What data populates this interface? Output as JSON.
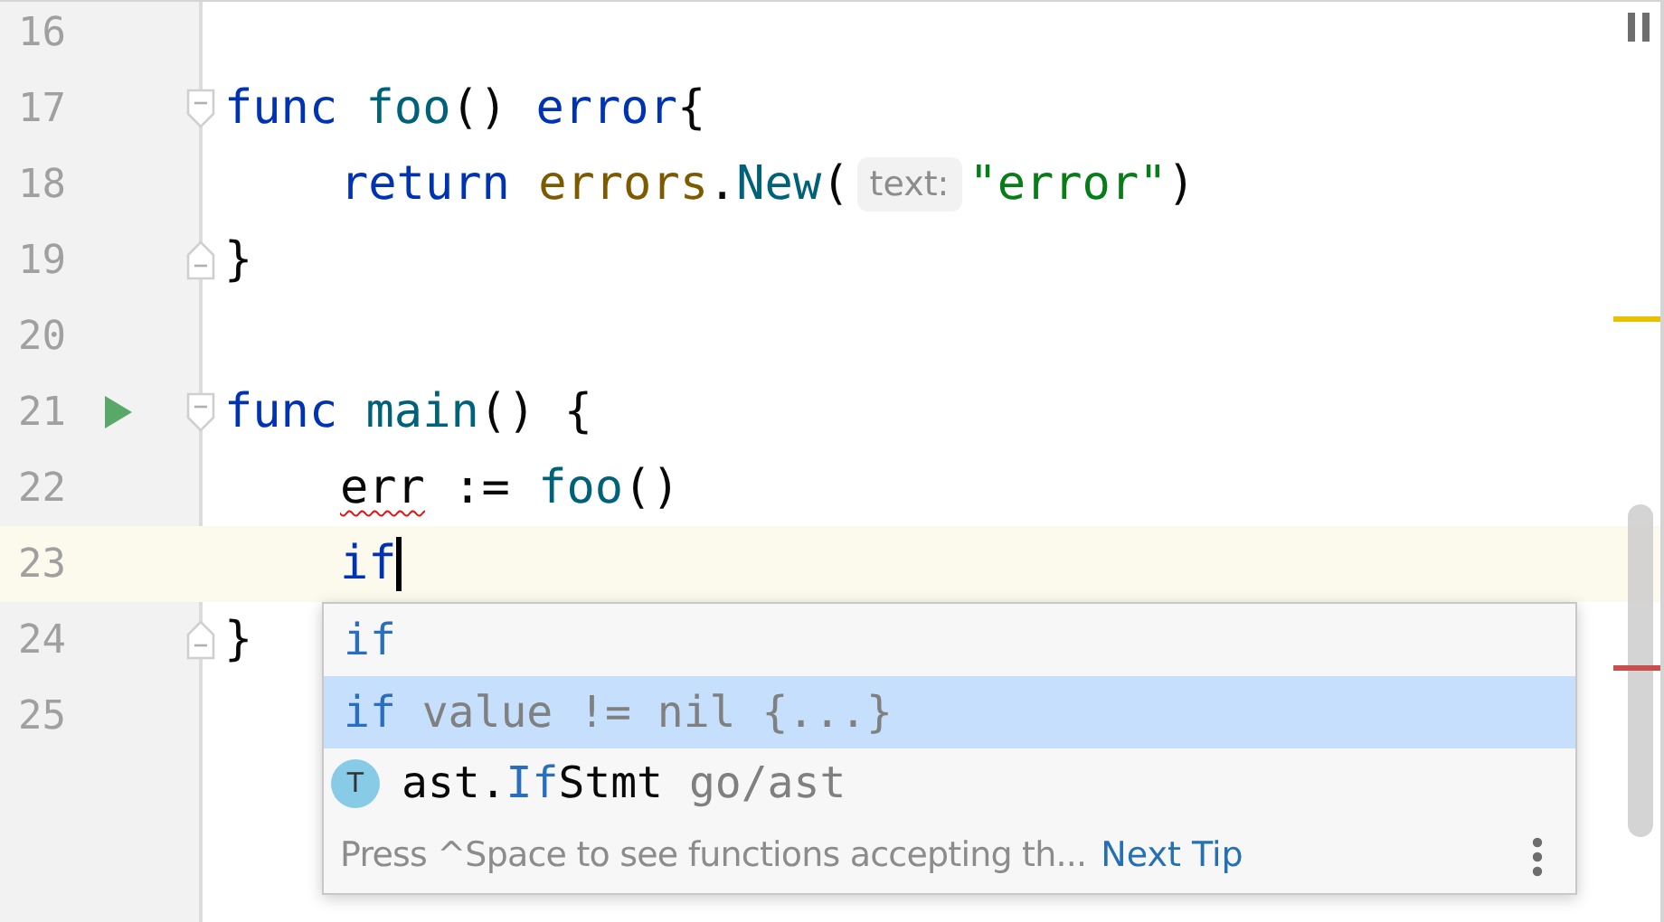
{
  "editor": {
    "lines": [
      {
        "number": "16",
        "kind": "plain",
        "current": false,
        "caret": false
      },
      {
        "number": "17",
        "kind": "fold-start",
        "current": false,
        "caret": false,
        "indent": false,
        "tokens": [
          {
            "kind": "keyword",
            "text": "func"
          },
          {
            "kind": "function",
            "text": " foo"
          },
          {
            "kind": "plain",
            "text": "() "
          },
          {
            "kind": "keyword",
            "text": "error"
          },
          {
            "kind": "plain",
            "text": "{"
          }
        ]
      },
      {
        "number": "18",
        "kind": "plain",
        "current": false,
        "caret": false,
        "indent": true,
        "tokens": [
          {
            "kind": "keyword",
            "text": "return"
          },
          {
            "kind": "package",
            "text": " errors"
          },
          {
            "kind": "plain",
            "text": "."
          },
          {
            "kind": "function",
            "text": "New"
          },
          {
            "kind": "plain",
            "text": "("
          },
          {
            "kind": "hint",
            "text": "text:"
          },
          {
            "kind": "string",
            "text": "\"error\""
          },
          {
            "kind": "plain",
            "text": ")"
          }
        ]
      },
      {
        "number": "19",
        "kind": "fold-end",
        "current": false,
        "caret": false,
        "indent": false,
        "tokens": [
          {
            "kind": "plain",
            "text": "}"
          }
        ]
      },
      {
        "number": "20",
        "kind": "plain",
        "current": false,
        "caret": false
      },
      {
        "number": "21",
        "kind": "run-fold-start",
        "current": false,
        "caret": false,
        "indent": false,
        "tokens": [
          {
            "kind": "keyword",
            "text": "func"
          },
          {
            "kind": "function",
            "text": " main"
          },
          {
            "kind": "plain",
            "text": "() {"
          }
        ]
      },
      {
        "number": "22",
        "kind": "plain",
        "current": false,
        "caret": false,
        "indent": true,
        "tokens": [
          {
            "kind": "unused",
            "text": "err"
          },
          {
            "kind": "plain",
            "text": " := "
          },
          {
            "kind": "function",
            "text": "foo"
          },
          {
            "kind": "plain",
            "text": "()"
          }
        ]
      },
      {
        "number": "23",
        "kind": "plain",
        "current": true,
        "caret": true,
        "indent": true,
        "tokens": [
          {
            "kind": "keyword",
            "text": "if"
          }
        ]
      },
      {
        "number": "24",
        "kind": "fold-end",
        "current": false,
        "caret": false,
        "indent": false,
        "tokens": [
          {
            "kind": "plain",
            "text": "}"
          }
        ]
      },
      {
        "number": "25",
        "kind": "plain",
        "current": false,
        "caret": false
      }
    ]
  },
  "completion": {
    "items": [
      {
        "selected": false,
        "parts": [
          {
            "kind": "keyword",
            "text": "if"
          }
        ]
      },
      {
        "selected": true,
        "parts": [
          {
            "kind": "keyword",
            "text": "if"
          },
          {
            "kind": "template",
            "text": " value != nil {...}"
          }
        ]
      },
      {
        "selected": false,
        "badge": "T",
        "parts": [
          {
            "kind": "plain",
            "text": "ast."
          },
          {
            "kind": "match",
            "text": "If"
          },
          {
            "kind": "plain",
            "text": "Stmt"
          },
          {
            "kind": "template",
            "text": " go/ast"
          }
        ]
      }
    ],
    "tip": "Press ^Space to see functions accepting th...",
    "tip_link": "Next Tip"
  }
}
